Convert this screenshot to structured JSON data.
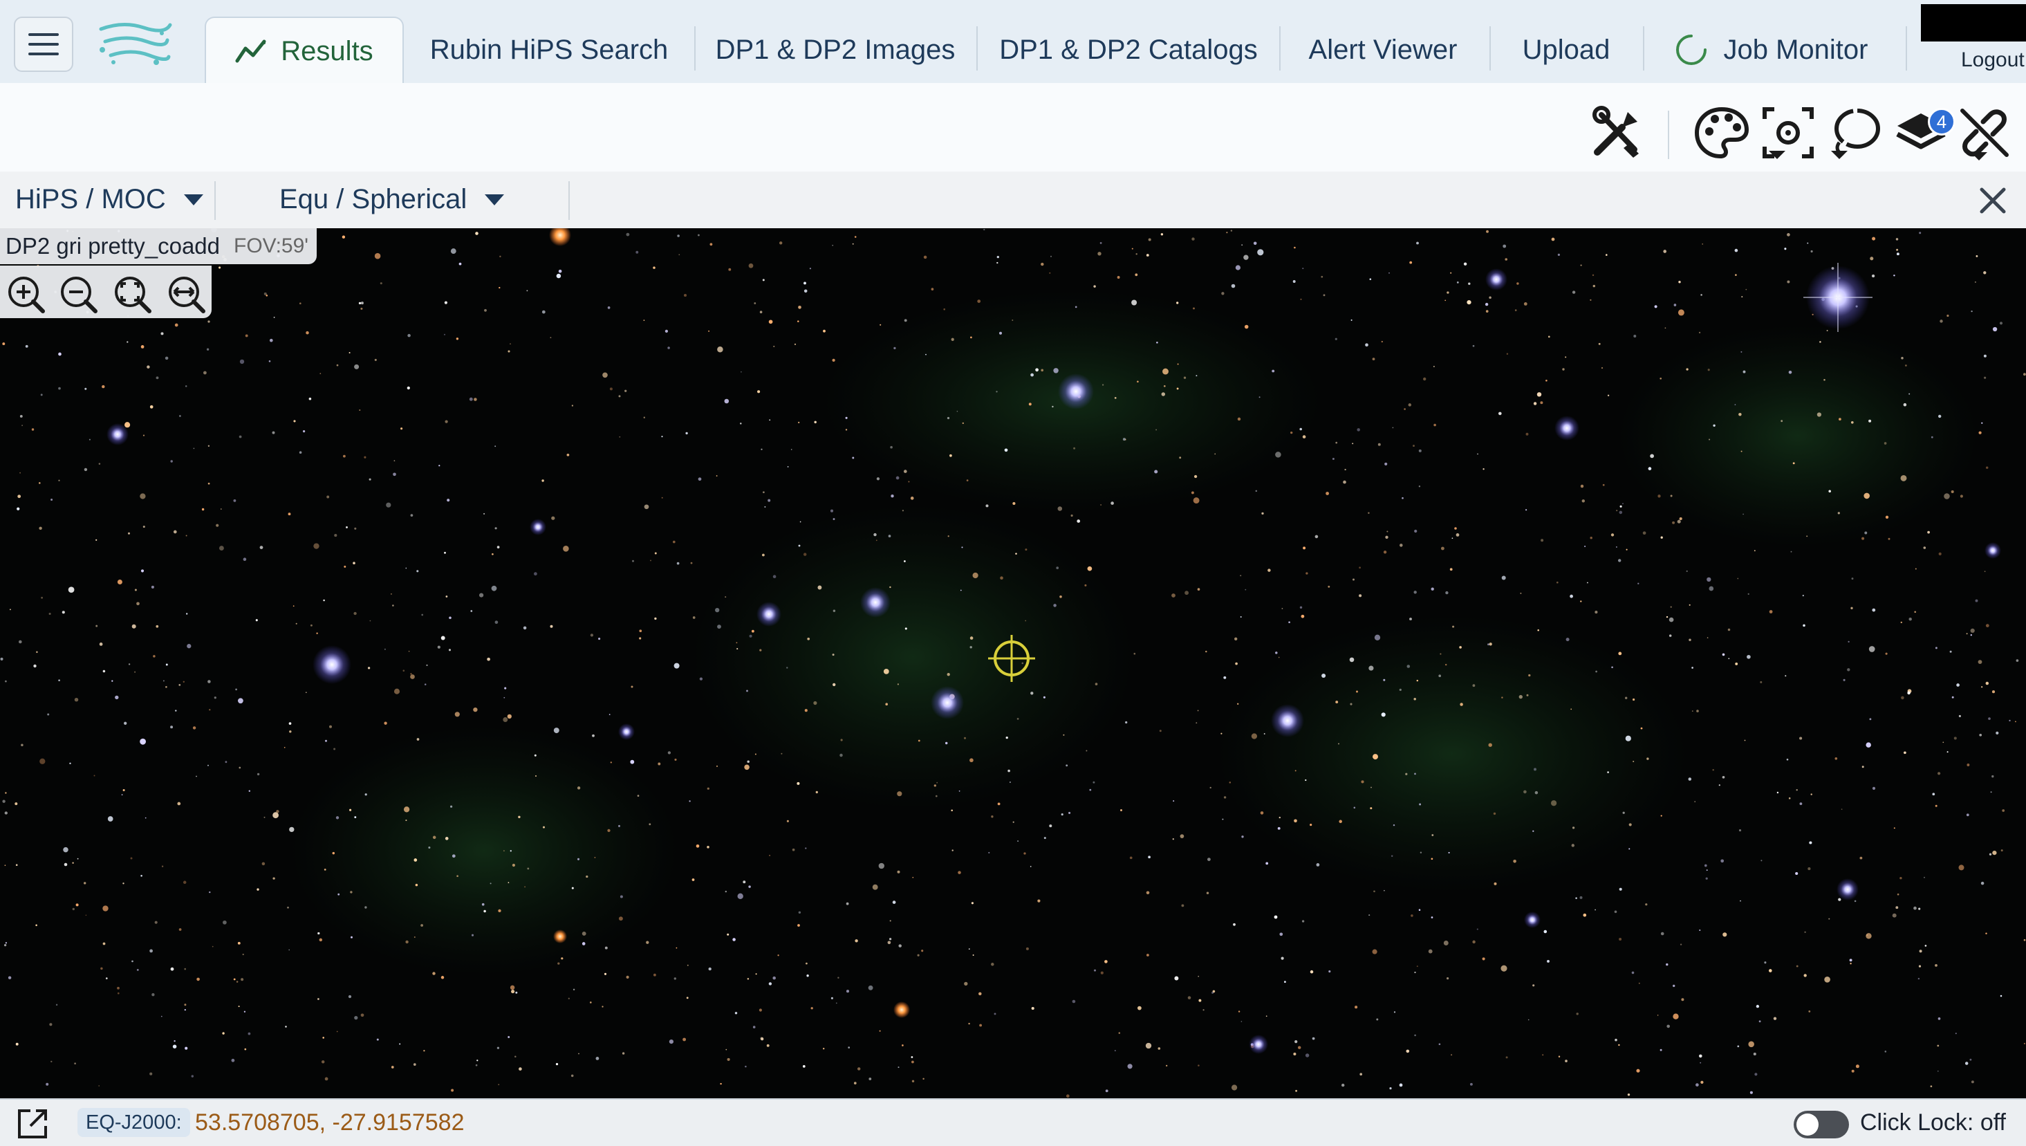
{
  "app": {
    "logout_label": "Logout"
  },
  "tabs": [
    {
      "label": "Results",
      "icon": "chart-line-icon",
      "active": true
    },
    {
      "label": "Rubin HiPS Search"
    },
    {
      "label": "DP1 & DP2 Images"
    },
    {
      "label": "DP1 & DP2 Catalogs"
    },
    {
      "label": "Alert Viewer"
    },
    {
      "label": "Upload"
    },
    {
      "label": "Job Monitor",
      "icon": "spinner-icon"
    }
  ],
  "toolbar": {
    "tools": [
      "tools-icon",
      "palette-icon",
      "target-select-icon",
      "lasso-icon",
      "layers-icon",
      "unlink-icon"
    ],
    "layers_count": "4"
  },
  "hips_header": {
    "type_select": "HiPS / MOC",
    "coord_select": "Equ / Spherical"
  },
  "image": {
    "title": "DP2 gri pretty_coadd",
    "fov": "FOV:59'"
  },
  "status_bar": {
    "coord_system": "EQ-J2000:",
    "coordinates": "53.5708705, -27.9157582",
    "click_lock": "Click Lock: off"
  },
  "colors": {
    "accent": "#23643b",
    "tab_text": "#1e3a5a",
    "coord_value": "#9b5b17",
    "badge": "#2f6fd6",
    "sky_background": "#040505",
    "marker": "#d8cf3a"
  }
}
